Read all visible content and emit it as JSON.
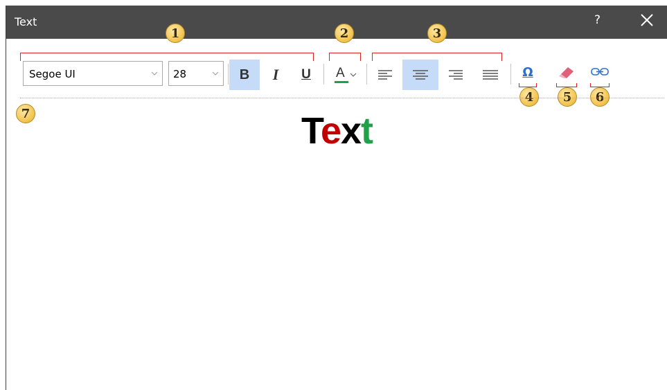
{
  "window": {
    "title": "Text",
    "help_label": "?"
  },
  "toolbar": {
    "font_family": "Segoe UI",
    "font_size": "28",
    "bold_label": "B",
    "italic_label": "I",
    "underline_label": "U",
    "font_color_label": "A",
    "font_color_bar": "#1aa24a",
    "alignment_active": "center"
  },
  "callouts": [
    "1",
    "2",
    "3",
    "4",
    "5",
    "6",
    "7"
  ],
  "editor": {
    "segments": [
      {
        "text": "T",
        "color": "#000000"
      },
      {
        "text": "e",
        "color": "#c00000"
      },
      {
        "text": "x",
        "color": "#000000"
      },
      {
        "text": "t",
        "color": "#21a04a"
      }
    ]
  },
  "colors": {
    "titlebar": "#4a4a4a",
    "active_button": "#c6dbf7",
    "callout_bracket": "#e0201f",
    "icon_blue": "#2b6fcf",
    "eraser": "#e0607a"
  }
}
